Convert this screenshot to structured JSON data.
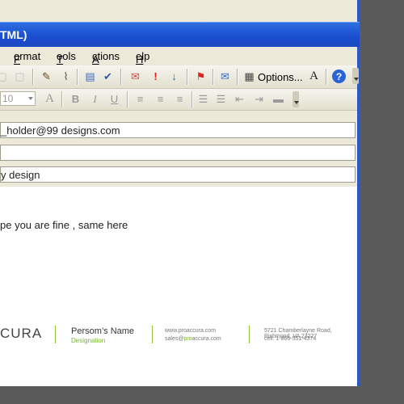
{
  "window": {
    "title": "TML)"
  },
  "menu": {
    "items": [
      "Format",
      "Tools",
      "Actions",
      "Help"
    ]
  },
  "toolbar": {
    "options_label": "Options...",
    "font_size": "10"
  },
  "fields": {
    "to_value": "_holder@99 designs.com",
    "cc_value": "",
    "subject_value": "y design"
  },
  "body": {
    "text": "pe you are fine , same here"
  },
  "signature": {
    "logo_text": "CURA",
    "name": "Persom’s Name",
    "designation": "Designation",
    "website": "www.proaccura.com",
    "email_prefix": "sales@",
    "email_brand": "pro",
    "email_suffix": "accura.com",
    "address": "5721 Chamberlayne Road, Richmond, VA 23227",
    "cell": "cell: 1-866-551-4374"
  },
  "colors": {
    "title_blue": "#1a4fd0",
    "accent_green": "#7ab32e",
    "help_blue": "#2b63d6"
  }
}
